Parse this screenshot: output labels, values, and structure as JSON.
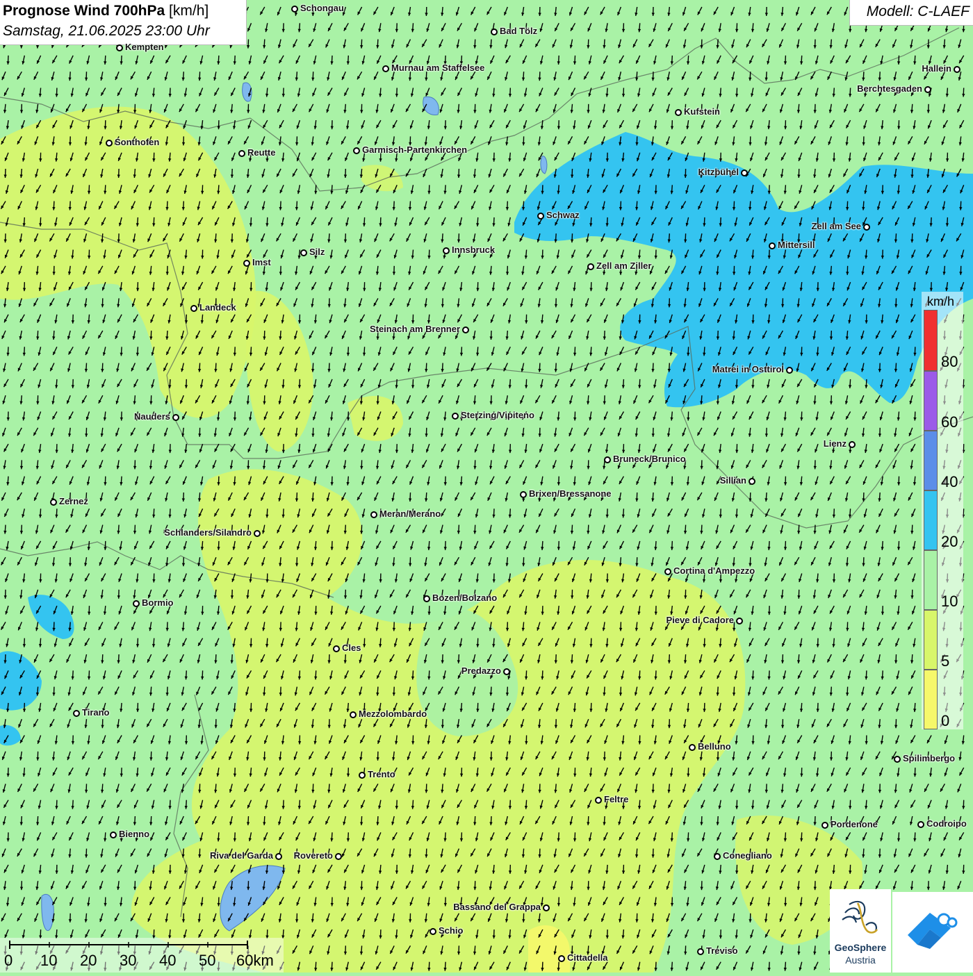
{
  "title": {
    "main_bold": "Prognose Wind 700hPa",
    "main_unit": " [km/h]",
    "datetime": "Samstag, 21.06.2025 23:00 Uhr"
  },
  "model": "Modell: C-LAEF",
  "legend": {
    "unit": "km/h",
    "ticks": [
      "80",
      "60",
      "40",
      "20",
      "10",
      "5",
      "0"
    ],
    "colors": {
      "band_0_5": "#f6f86a",
      "band_5_10": "#d8f66a",
      "band_10_20": "#a9f2a6",
      "band_20_40": "#34c4f0",
      "band_40_60": "#5b8ee8",
      "band_60_80": "#9b5be8",
      "band_80_plus": "#f03030"
    }
  },
  "scale_bar": {
    "labels": [
      "0",
      "10",
      "20",
      "30",
      "40",
      "50",
      "60km"
    ]
  },
  "logos": {
    "geosphere_line1": "GeoSphere",
    "geosphere_line2": "Austria",
    "icons": [
      "geosphere-logo-icon",
      "wind-app-logo-icon"
    ]
  },
  "cities": [
    {
      "name": "Schongau"
    },
    {
      "name": "Bad Tölz"
    },
    {
      "name": "Kempten"
    },
    {
      "name": "Murnau am Staffelsee"
    },
    {
      "name": "Hallein"
    },
    {
      "name": "Berchtesgaden"
    },
    {
      "name": "Kufstein"
    },
    {
      "name": "Sonthofen"
    },
    {
      "name": "Reutte"
    },
    {
      "name": "Garmisch-Partenkirchen"
    },
    {
      "name": "Kitzbühel"
    },
    {
      "name": "Schwaz"
    },
    {
      "name": "Zell am See"
    },
    {
      "name": "Mittersill"
    },
    {
      "name": "Innsbruck"
    },
    {
      "name": "Silz"
    },
    {
      "name": "Imst"
    },
    {
      "name": "Zell am Ziller"
    },
    {
      "name": "Landeck"
    },
    {
      "name": "Steinach am Brenner"
    },
    {
      "name": "Matrei in Osttirol"
    },
    {
      "name": "Nauders"
    },
    {
      "name": "Sterzing/Vipiteno"
    },
    {
      "name": "Lienz"
    },
    {
      "name": "Bruneck/Brunico"
    },
    {
      "name": "Sillian"
    },
    {
      "name": "Brixen/Bressanone"
    },
    {
      "name": "Zernez"
    },
    {
      "name": "Meran/Merano"
    },
    {
      "name": "Schlanders/Silandro"
    },
    {
      "name": "Cortina d'Ampezzo"
    },
    {
      "name": "Bozen/Bolzano"
    },
    {
      "name": "Bormio"
    },
    {
      "name": "Pieve di Cadore"
    },
    {
      "name": "Cles"
    },
    {
      "name": "Predazzo"
    },
    {
      "name": "Tirano"
    },
    {
      "name": "Mezzolombardo"
    },
    {
      "name": "Belluno"
    },
    {
      "name": "Spilimbergo"
    },
    {
      "name": "Trento"
    },
    {
      "name": "Feltre"
    },
    {
      "name": "Pordenone"
    },
    {
      "name": "Codroipo"
    },
    {
      "name": "Bienno"
    },
    {
      "name": "Riva del Garda"
    },
    {
      "name": "Rovereto"
    },
    {
      "name": "Conegliano"
    },
    {
      "name": "Bassano del Grappa"
    },
    {
      "name": "Schio"
    },
    {
      "name": "Treviso"
    },
    {
      "name": "Cittadella"
    }
  ]
}
